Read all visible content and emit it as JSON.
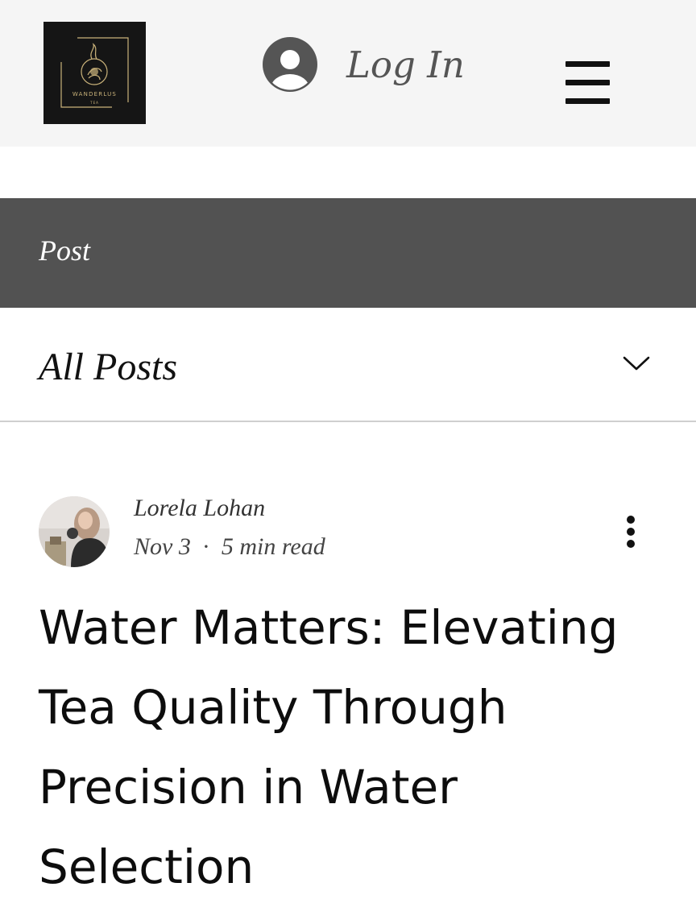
{
  "header": {
    "logo": {
      "brand": "WANDERLUS",
      "sub": "TEA",
      "accent_color": "#c9b27a",
      "background_color": "#151515"
    },
    "login": {
      "icon": "user-avatar-icon",
      "label": "Log In"
    },
    "menu_icon": "hamburger-menu-icon"
  },
  "section_header": {
    "title": "Post",
    "background_color": "#525252"
  },
  "category_selector": {
    "selected": "All Posts",
    "icon": "chevron-down-icon"
  },
  "post": {
    "author": "Lorela Lohan",
    "date": "Nov 3",
    "separator": "·",
    "read_time": "5 min read",
    "more_icon": "more-vertical-icon",
    "title": "Water Matters: Elevating Tea Quality Through Precision in Water Selection"
  }
}
